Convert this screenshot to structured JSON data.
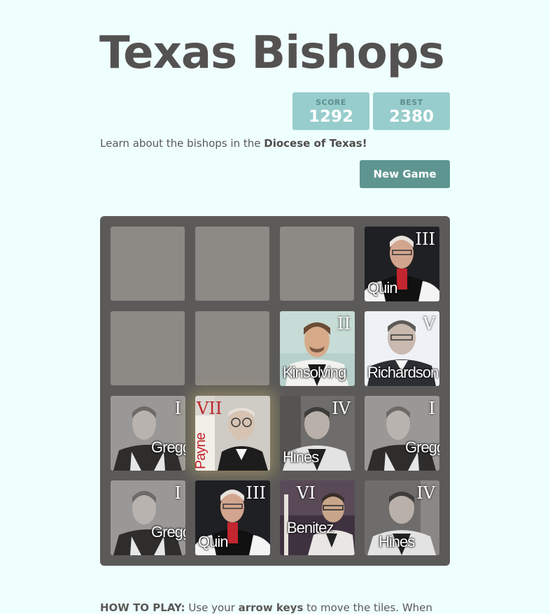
{
  "header": {
    "title": "Texas Bishops"
  },
  "scores": {
    "score_label": "SCORE",
    "score_value": "1292",
    "best_label": "BEST",
    "best_value": "2380"
  },
  "intro": {
    "prefix": "Learn about the bishops in the ",
    "bold": "Diocese of Texas!"
  },
  "buttons": {
    "new_game": "New Game"
  },
  "board": {
    "tiles": [
      {
        "numeral": "III",
        "name": "Quin"
      },
      {
        "numeral": "II",
        "name": "Kinsolving"
      },
      {
        "numeral": "V",
        "name": "Richardson"
      },
      {
        "numeral": "I",
        "name": "Gregg"
      },
      {
        "numeral": "VII",
        "name": "Payne"
      },
      {
        "numeral": "IV",
        "name": "Hines"
      },
      {
        "numeral": "I",
        "name": "Gregg"
      },
      {
        "numeral": "I",
        "name": "Gregg"
      },
      {
        "numeral": "III",
        "name": "Quin"
      },
      {
        "numeral": "VI",
        "name": "Benitez"
      },
      {
        "numeral": "IV",
        "name": "Hines"
      }
    ]
  },
  "howto": {
    "label": "HOW TO PLAY:",
    "text1": " Use your ",
    "bold": "arrow keys",
    "text2": " to move the tiles. When"
  }
}
